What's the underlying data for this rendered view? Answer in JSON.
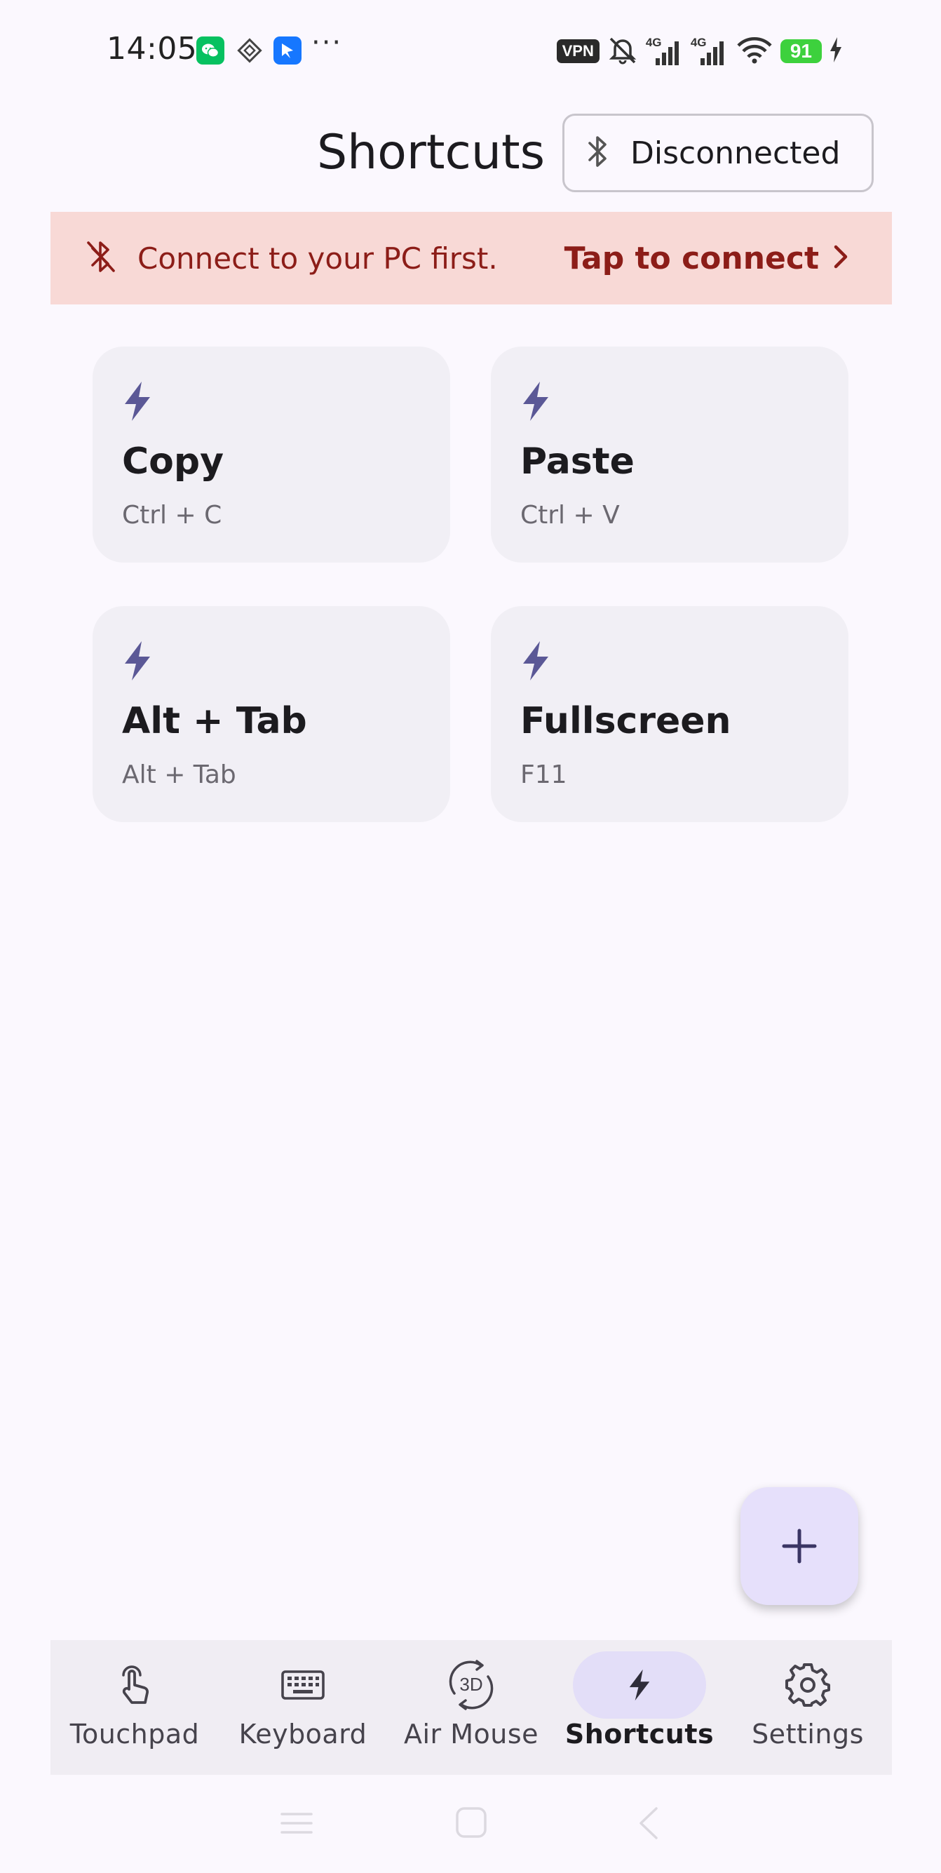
{
  "status_bar": {
    "time": "14:05",
    "vpn_label": "VPN",
    "network_1": "4G",
    "network_2": "4G",
    "battery": "91",
    "icons": [
      "wechat-icon",
      "diamond-app-icon",
      "bluebird-app-icon",
      "more-dots",
      "mute-icon",
      "signal-icon",
      "wifi-icon",
      "charging-icon"
    ]
  },
  "header": {
    "title": "Shortcuts",
    "connection_status": "Disconnected"
  },
  "banner": {
    "message": "Connect to your PC first.",
    "action": "Tap to connect"
  },
  "shortcuts": [
    {
      "name": "Copy",
      "keys": "Ctrl + C"
    },
    {
      "name": "Paste",
      "keys": "Ctrl + V"
    },
    {
      "name": "Alt + Tab",
      "keys": "Alt + Tab"
    },
    {
      "name": "Fullscreen",
      "keys": "F11"
    }
  ],
  "fab": {
    "icon": "plus-icon"
  },
  "bottom_nav": {
    "items": [
      {
        "label": "Touchpad",
        "icon": "touch-icon"
      },
      {
        "label": "Keyboard",
        "icon": "keyboard-icon"
      },
      {
        "label": "Air Mouse",
        "icon": "3d-rotation-icon",
        "icon_text": "3D"
      },
      {
        "label": "Shortcuts",
        "icon": "bolt-icon",
        "active": true
      },
      {
        "label": "Settings",
        "icon": "gear-icon"
      }
    ]
  },
  "colors": {
    "background": "#fbf8fe",
    "banner_bg": "#f8d9d6",
    "banner_text": "#8c1d18",
    "card_bg": "#f1eff5",
    "accent": "#5b5896",
    "fab_bg": "#e6e0fb",
    "nav_bg": "#f0edf3",
    "nav_active_pill": "#e3def8"
  }
}
